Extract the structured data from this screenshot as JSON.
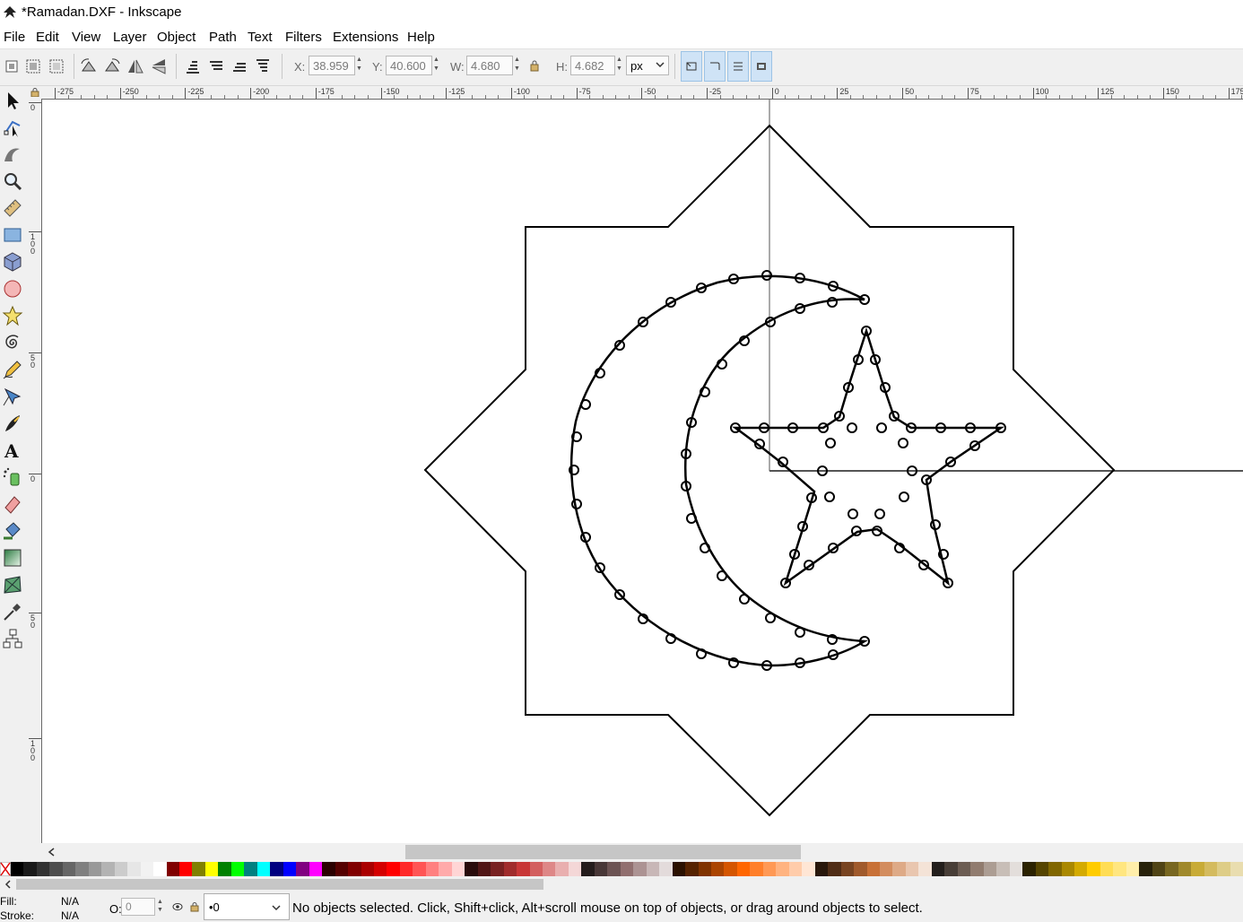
{
  "window": {
    "title": "*Ramadan.DXF - Inkscape"
  },
  "menu": [
    {
      "label": "File",
      "key": "file"
    },
    {
      "label": "Edit",
      "key": "edit"
    },
    {
      "label": "View",
      "key": "view"
    },
    {
      "label": "Layer",
      "key": "layer"
    },
    {
      "label": "Object",
      "key": "object"
    },
    {
      "label": "Path",
      "key": "path"
    },
    {
      "label": "Text",
      "key": "text"
    },
    {
      "label": "Filters",
      "key": "filters"
    },
    {
      "label": "Extensions",
      "key": "extensions"
    },
    {
      "label": "Help",
      "key": "help"
    }
  ],
  "toolbar": {
    "x_label": "X:",
    "x_value": "38.959",
    "y_label": "Y:",
    "y_value": "40.600",
    "w_label": "W:",
    "w_value": "4.680",
    "h_label": "H:",
    "h_value": "4.682",
    "unit": "px"
  },
  "ruler": {
    "h_ticks": [
      "-275",
      "-250",
      "-225",
      "-200",
      "-175",
      "-150",
      "-125",
      "-100",
      "-75",
      "-50",
      "-25",
      "0",
      "25",
      "50",
      "75",
      "100",
      "125",
      "150",
      "175"
    ],
    "v_ticks": [
      "0",
      "100",
      "50",
      "0",
      "50",
      "100"
    ]
  },
  "tools": [
    "selector-icon",
    "node-icon",
    "tweak-icon",
    "zoom-icon",
    "measure-icon",
    "rect-icon",
    "3dbox-icon",
    "ellipse-icon",
    "star-icon",
    "spiral-icon",
    "pencil-icon",
    "pen-icon",
    "calligraphy-icon",
    "text-icon",
    "spray-icon",
    "eraser-icon",
    "bucket-icon",
    "gradient-icon",
    "mesh-icon",
    "dropper-icon",
    "connector-icon"
  ],
  "palette": [
    "#000000",
    "#1a1a1a",
    "#333333",
    "#4d4d4d",
    "#666666",
    "#808080",
    "#999999",
    "#b3b3b3",
    "#cccccc",
    "#e6e6e6",
    "#f2f2f2",
    "#ffffff",
    "#800000",
    "#ff0000",
    "#808000",
    "#ffff00",
    "#008000",
    "#00ff00",
    "#008080",
    "#00ffff",
    "#000080",
    "#0000ff",
    "#800080",
    "#ff00ff",
    "#2b0000",
    "#550000",
    "#800000",
    "#aa0000",
    "#d40000",
    "#ff0000",
    "#ff2a2a",
    "#ff5555",
    "#ff8080",
    "#ffaaaa",
    "#ffd5d5",
    "#280b0b",
    "#501616",
    "#782121",
    "#a02c2c",
    "#c83737",
    "#d35f5f",
    "#de8787",
    "#e9afaf",
    "#f4d7d7",
    "#241c1c",
    "#483737",
    "#6c5353",
    "#916f6f",
    "#ac9393",
    "#c8b7b7",
    "#e3dbdb",
    "#2b1100",
    "#552200",
    "#803300",
    "#aa4400",
    "#d45500",
    "#ff6600",
    "#ff7f2a",
    "#ff9955",
    "#ffb380",
    "#ffccaa",
    "#ffe6d5",
    "#28170b",
    "#502d16",
    "#784421",
    "#a05a2c",
    "#c87137",
    "#d38d5f",
    "#deaa87",
    "#e9c6af",
    "#f4e3d7",
    "#241f1c",
    "#483e37",
    "#6c5d53",
    "#917c6f",
    "#ac9d93",
    "#c8beb7",
    "#e3dedb",
    "#2b2200",
    "#554400",
    "#806600",
    "#aa8800",
    "#d4aa00",
    "#ffcc00",
    "#ffdd55",
    "#ffe680",
    "#ffeeaa",
    "#28220b",
    "#504416",
    "#786721",
    "#a0892c",
    "#c8ab37",
    "#d4bb5f",
    "#decd87",
    "#e9ddaf"
  ],
  "status": {
    "fill_label": "Fill:",
    "fill_value": "N/A",
    "stroke_label": "Stroke:",
    "stroke_value": "N/A",
    "opacity_label": "O:",
    "opacity_value": "0",
    "layer_value": "•0",
    "message": "No objects selected. Click, Shift+click, Alt+scroll mouse on top of objects, or drag around objects to select."
  }
}
